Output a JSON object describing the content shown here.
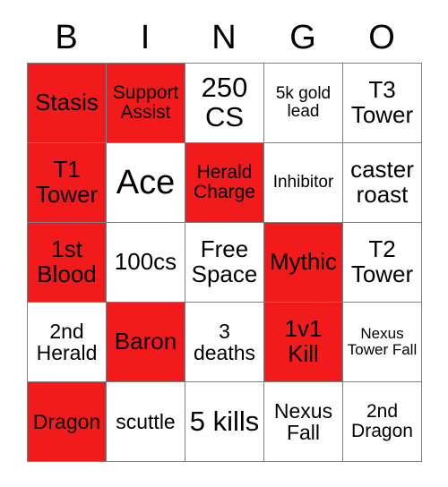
{
  "card": {
    "title_letters": [
      "B",
      "I",
      "N",
      "G",
      "O"
    ],
    "marked_color": "#F21A1A",
    "unmarked_color": "#FFFFFF",
    "text_color": "#000000",
    "border_color": "#808080",
    "rows": [
      [
        {
          "label": "Stasis",
          "marked": true,
          "size": "fs-md"
        },
        {
          "label": "Support Assist",
          "marked": true,
          "size": "fs-xs"
        },
        {
          "label": "250 CS",
          "marked": false,
          "size": "fs-lg"
        },
        {
          "label": "5k gold lead",
          "marked": false,
          "size": "fs-xxs"
        },
        {
          "label": "T3 Tower",
          "marked": false,
          "size": "fs-md"
        }
      ],
      [
        {
          "label": "T1 Tower",
          "marked": true,
          "size": "fs-md"
        },
        {
          "label": "Ace",
          "marked": false,
          "size": "fs-xl"
        },
        {
          "label": "Herald Charge",
          "marked": true,
          "size": "fs-xs"
        },
        {
          "label": "Inhibitor",
          "marked": false,
          "size": "fs-xxs"
        },
        {
          "label": "caster roast",
          "marked": false,
          "size": "fs-md"
        }
      ],
      [
        {
          "label": "1st Blood",
          "marked": true,
          "size": "fs-md"
        },
        {
          "label": "100cs",
          "marked": false,
          "size": "fs-md"
        },
        {
          "label": "Free Space",
          "marked": false,
          "size": "fs-md"
        },
        {
          "label": "Mythic",
          "marked": true,
          "size": "fs-md"
        },
        {
          "label": "T2 Tower",
          "marked": false,
          "size": "fs-md"
        }
      ],
      [
        {
          "label": "2nd Herald",
          "marked": false,
          "size": "fs-sm"
        },
        {
          "label": "Baron",
          "marked": true,
          "size": "fs-md"
        },
        {
          "label": "3 deaths",
          "marked": false,
          "size": "fs-sm"
        },
        {
          "label": "1v1 Kill",
          "marked": true,
          "size": "fs-md"
        },
        {
          "label": "Nexus Tower Fall",
          "marked": false,
          "size": "fs-tiny"
        }
      ],
      [
        {
          "label": "Dragon",
          "marked": true,
          "size": "fs-sm"
        },
        {
          "label": "scuttle",
          "marked": false,
          "size": "fs-sm"
        },
        {
          "label": "5 kills",
          "marked": false,
          "size": "fs-lg"
        },
        {
          "label": "Nexus Fall",
          "marked": false,
          "size": "fs-sm"
        },
        {
          "label": "2nd Dragon",
          "marked": false,
          "size": "fs-xs"
        }
      ]
    ]
  }
}
